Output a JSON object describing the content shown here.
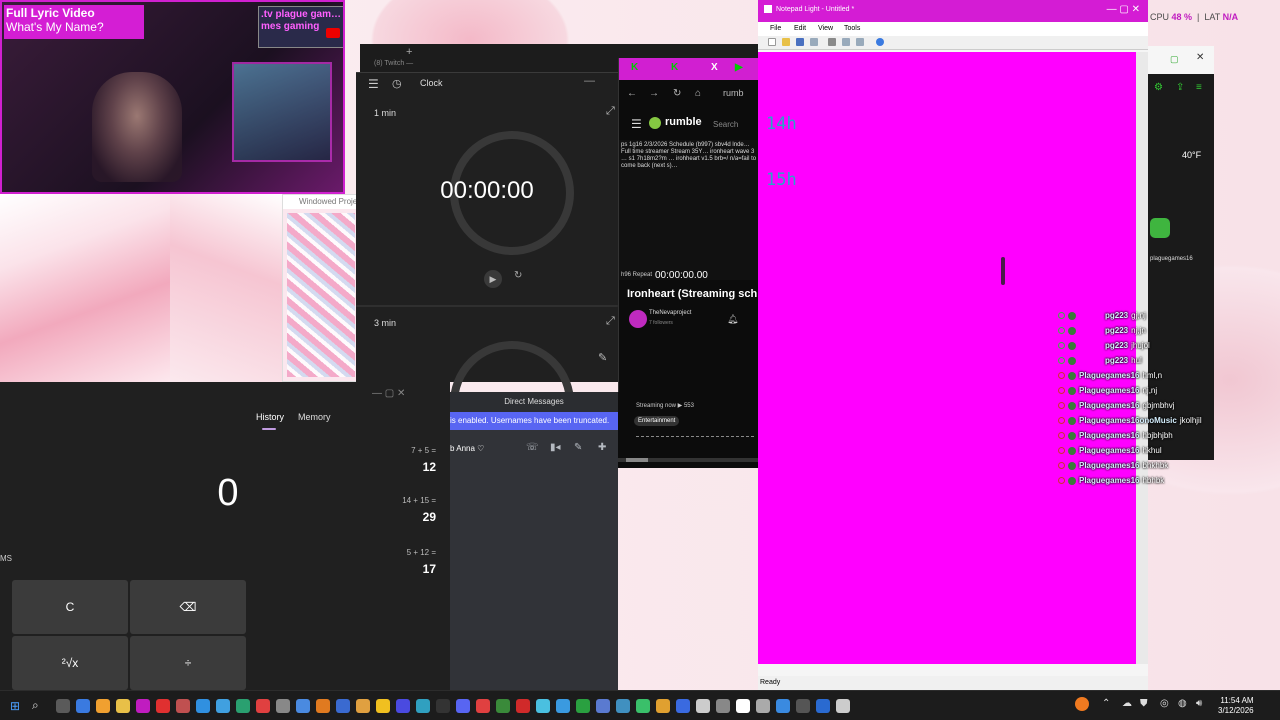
{
  "lyric_video": {
    "title": "Full Lyric Video",
    "subtitle": "What's My Name?",
    "thumb_text": ".tv plague gam… mes gaming"
  },
  "windowed_projector": {
    "label": "Windowed Project…"
  },
  "twitch_label": "(8) Twitch —",
  "clock": {
    "title": "Clock",
    "timer1": {
      "label": "1 min",
      "time": "00:00:00"
    },
    "timer2": {
      "label": "3 min"
    }
  },
  "browser": {
    "rumble_label": "rumble",
    "search_placeholder": "Search",
    "url_fragment": "rumb",
    "desc": "ps 1g16 2/3/2026 Schedule (b997) sbv4d lnde… Full time streamer Stream 35Y… ironheart wave 3 … s1 7h18m2?m … irohheart v1.5 brb=/ n/a=fail to come back (next s)…",
    "embed_timer": "00:00:00.00",
    "repeat_label": "h96 Repeat",
    "heading": "Ironheart (Streaming sch",
    "channel_name": "TheNevaproject",
    "channel_sub": "7 followers",
    "streaming": "Streaming now  ▶ 553",
    "tag": "Entertainment"
  },
  "notepad": {
    "title": "Notepad Light - Untitled *",
    "menu": [
      "File",
      "Edit",
      "View",
      "Tools"
    ],
    "lines": [
      "14h",
      "15h"
    ],
    "status": "Ready",
    "bg_color": "#ff00ff",
    "text_color": "#2aa4c8"
  },
  "stats": {
    "cpu_label": "CPU",
    "cpu_value": "48 %",
    "lat_label": "LAT",
    "lat_value": "N/A"
  },
  "side_widget": {
    "weather": "40°F",
    "user": "plaguegames16"
  },
  "chat": [
    {
      "user": "pg223",
      "msg": "gj,nj"
    },
    {
      "user": "pg223",
      "msg": "nj,jn"
    },
    {
      "user": "pg223",
      "msg": "jhujol"
    },
    {
      "user": "pg223",
      "msg": "hul"
    },
    {
      "user": "Plaguegames16",
      "msg": "hml,n"
    },
    {
      "user": "Plaguegames16",
      "msg": "nj,nj"
    },
    {
      "user": "Plaguegames16",
      "msg": "gbjmbhvj"
    },
    {
      "user": "Plaguegames16onoMusic",
      "msg": "jkolhjil"
    },
    {
      "user": "Plaguegames16",
      "msg": "hbjbhjbh"
    },
    {
      "user": "Plaguegames16",
      "msg": "hkhul"
    },
    {
      "user": "Plaguegames16",
      "msg": "bhkhbk"
    },
    {
      "user": "Plaguegames16",
      "msg": "hbhbk"
    }
  ],
  "calculator": {
    "tab_history": "History",
    "tab_memory": "Memory",
    "display": "0",
    "ms_label": "MS",
    "history": [
      {
        "expr": "7  +  5 =",
        "result": "12"
      },
      {
        "expr": "14  +  15 =",
        "result": "29"
      },
      {
        "expr": "5  +  12 =",
        "result": "17"
      }
    ],
    "keys": [
      "C",
      "⌫",
      "²√x",
      "÷"
    ]
  },
  "discord": {
    "header": "Direct Messages",
    "banner": "is enabled. Usernames have been truncated.",
    "contact": "b Anna ♡"
  },
  "taskbar": {
    "time": "11:54 AM",
    "date": "3/12/2026"
  }
}
